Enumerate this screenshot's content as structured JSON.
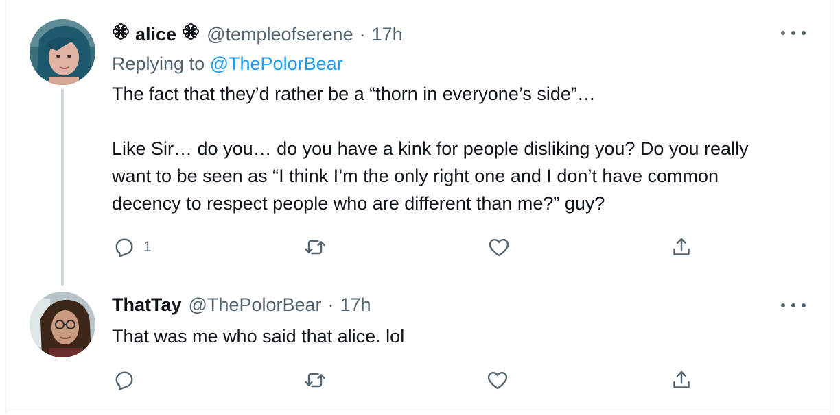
{
  "tweets": [
    {
      "display_name": "alice",
      "handle": "@templeofserene",
      "separator": "·",
      "time": "17h",
      "replying_prefix": "Replying to",
      "replying_to": "@ThePolorBear",
      "text_lines": [
        "The fact that they’d rather be a “thorn in everyone’s side”…",
        "",
        "Like Sir… do you… do you have a kink for people disliking you? Do you really",
        "want to be seen as “I think I’m the only right one and I don’t have common",
        "decency to respect people who are different than me?” guy?"
      ],
      "reply_count": "1"
    },
    {
      "display_name": "ThatTay",
      "handle": "@ThePolorBear",
      "separator": "·",
      "time": "17h",
      "text_lines": [
        "That was me who said that alice. lol"
      ],
      "reply_count": ""
    }
  ],
  "icons": [
    "flower-icon",
    "more-icon",
    "reply-icon",
    "retweet-icon",
    "like-icon",
    "share-icon"
  ],
  "colors": {
    "text": "#0f1419",
    "secondary": "#536471",
    "link": "#1d9bf0",
    "thread_line": "#cfd9de"
  }
}
